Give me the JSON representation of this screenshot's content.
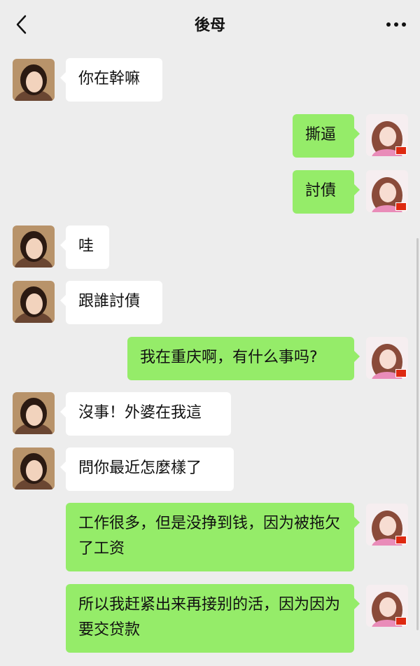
{
  "header": {
    "title": "後母",
    "back_icon": "chevron-left-icon",
    "more_icon": "more-icon"
  },
  "colors": {
    "background": "#ededed",
    "sent_bubble": "#95ec69",
    "received_bubble": "#ffffff"
  },
  "messages": [
    {
      "side": "left",
      "text": "你在幹嘛"
    },
    {
      "side": "right",
      "text": "撕逼"
    },
    {
      "side": "right",
      "text": "討債"
    },
    {
      "side": "left",
      "text": "哇"
    },
    {
      "side": "left",
      "text": "跟誰討債"
    },
    {
      "side": "right",
      "text": "我在重庆啊，有什么事吗?"
    },
    {
      "side": "left",
      "text": "沒事！外婆在我這"
    },
    {
      "side": "left",
      "text": "問你最近怎麼樣了"
    },
    {
      "side": "right",
      "text": "工作很多，但是没挣到钱，因为被拖欠了工资"
    },
    {
      "side": "right",
      "text": "所以我赶紧出来再接别的活，因为因为要交贷款"
    }
  ]
}
